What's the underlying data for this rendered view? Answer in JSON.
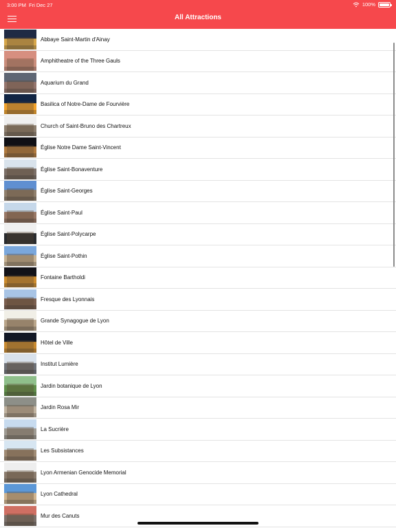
{
  "status_bar": {
    "time": "3:00 PM",
    "date": "Fri Dec 27",
    "battery_percent": "100%",
    "battery_level": 1.0,
    "wifi_icon": "wifi-icon",
    "battery_icon": "battery-icon"
  },
  "nav": {
    "title": "All Attractions",
    "menu_icon": "hamburger-menu-icon"
  },
  "colors": {
    "accent": "#f6484c",
    "row_separator": "#e3e3e3",
    "text": "#111111"
  },
  "attractions": [
    {
      "name": "Abbaye Saint-Martin d'Ainay",
      "thumb_colors": [
        "#1f2a44",
        "#d6a64a"
      ]
    },
    {
      "name": "Amphitheatre of the Three Gauls",
      "thumb_colors": [
        "#d78f80",
        "#c98d7b"
      ]
    },
    {
      "name": "Aquarium du Grand",
      "thumb_colors": [
        "#5e6674",
        "#94756d"
      ]
    },
    {
      "name": "Basilica of Notre-Dame de Fourvière",
      "thumb_colors": [
        "#112544",
        "#f1a32e"
      ]
    },
    {
      "name": "Church of Saint-Bruno des Chartreux",
      "thumb_colors": [
        "#efefef",
        "#8c7e6e"
      ]
    },
    {
      "name": "Église Notre Dame Saint-Vincent",
      "thumb_colors": [
        "#101015",
        "#b07a3e"
      ]
    },
    {
      "name": "Église Saint-Bonaventure",
      "thumb_colors": [
        "#d9e3ec",
        "#7b6f67"
      ]
    },
    {
      "name": "Église Saint-Georges",
      "thumb_colors": [
        "#5f8fd1",
        "#8f7f6c"
      ]
    },
    {
      "name": "Église Saint-Paul",
      "thumb_colors": [
        "#c6d8ea",
        "#987765"
      ]
    },
    {
      "name": "Église Saint-Polycarpe",
      "thumb_colors": [
        "#f0f0f0",
        "#2a2c2f"
      ]
    },
    {
      "name": "Église Saint-Pothin",
      "thumb_colors": [
        "#7aa7dc",
        "#c5b193"
      ]
    },
    {
      "name": "Fontaine Bartholdi",
      "thumb_colors": [
        "#121218",
        "#cc8c2e"
      ]
    },
    {
      "name": "Fresque des Lyonnais",
      "thumb_colors": [
        "#a8c4e5",
        "#7a5e4e"
      ]
    },
    {
      "name": "Grande Synagogue de Lyon",
      "thumb_colors": [
        "#f1efe7",
        "#b9a58a"
      ]
    },
    {
      "name": "Hôtel de Ville",
      "thumb_colors": [
        "#121826",
        "#c88a31"
      ]
    },
    {
      "name": "Institut Lumière",
      "thumb_colors": [
        "#d9e2ec",
        "#6f7278"
      ]
    },
    {
      "name": "Jardin botanique de Lyon",
      "thumb_colors": [
        "#8fbf8b",
        "#5f8d49"
      ]
    },
    {
      "name": "Jardin Rosa Mir",
      "thumb_colors": [
        "#8d8f88",
        "#c0b3a0"
      ]
    },
    {
      "name": "La Sucrière",
      "thumb_colors": [
        "#c7dbef",
        "#9e9a92"
      ]
    },
    {
      "name": "Les Subsistances",
      "thumb_colors": [
        "#d7e6f2",
        "#a08b74"
      ]
    },
    {
      "name": "Lyon Armenian Genocide Memorial",
      "thumb_colors": [
        "#eeeeee",
        "#8a7b6d"
      ]
    },
    {
      "name": "Lyon Cathedral",
      "thumb_colors": [
        "#5c98d8",
        "#d0b48f"
      ]
    },
    {
      "name": "Mur des Canuts",
      "thumb_colors": [
        "#cf6f63",
        "#7a6f69"
      ]
    }
  ]
}
